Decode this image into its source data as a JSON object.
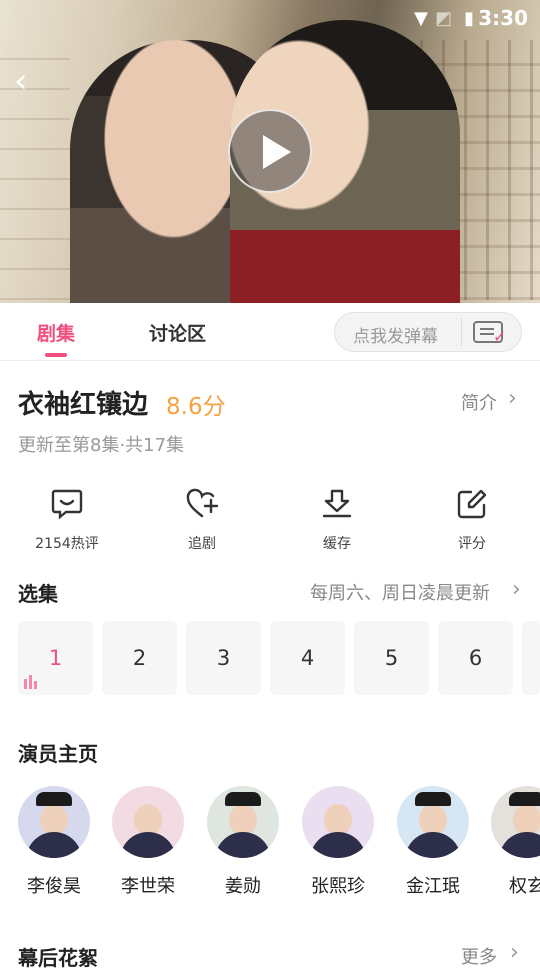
{
  "status_bar": {
    "time": "3:30"
  },
  "tabs": {
    "episodes": "剧集",
    "discussion": "讨论区"
  },
  "danmu": {
    "placeholder": "点我发弹幕"
  },
  "show": {
    "title": "衣袖红镶边",
    "score": "8.6分",
    "intro_label": "简介",
    "update_info": "更新至第8集·共17集"
  },
  "actions": [
    {
      "label": "2154热评",
      "icon": "comment-icon"
    },
    {
      "label": "追剧",
      "icon": "heart-plus-icon"
    },
    {
      "label": "缓存",
      "icon": "download-icon"
    },
    {
      "label": "评分",
      "icon": "edit-icon"
    }
  ],
  "episodes_section": {
    "title": "选集",
    "schedule": "每周六、周日凌晨更新",
    "items": [
      "1",
      "2",
      "3",
      "4",
      "5",
      "6"
    ],
    "selected": "1"
  },
  "actors_section": {
    "title": "演员主页",
    "actors": [
      "李俊昊",
      "李世荣",
      "姜勋",
      "张熙珍",
      "金江珉",
      "权玄"
    ]
  },
  "behind_section": {
    "title": "幕后花絮",
    "more": "更多"
  },
  "colors": {
    "accent": "#f05080",
    "score": "#f5a142"
  }
}
